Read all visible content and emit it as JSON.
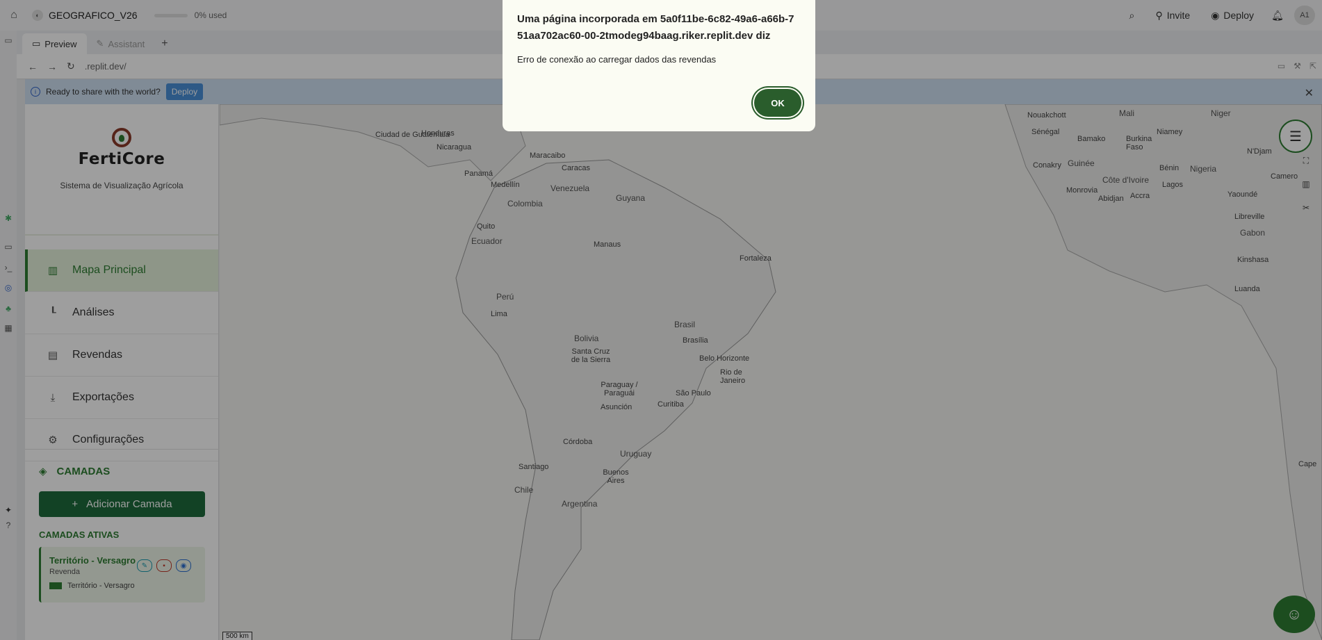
{
  "topbar": {
    "project_name": "GEOGRAFICO_V26",
    "usage": "0% used",
    "invite": "Invite",
    "deploy": "Deploy",
    "avatar": "A1"
  },
  "tabs": [
    {
      "label": "Preview"
    },
    {
      "label": "Assistant"
    },
    {
      "label": "+"
    }
  ],
  "urlbar": {
    "url": ".replit.dev/"
  },
  "banner": {
    "text": "Ready to share with the world?",
    "deploy_label": "Deploy"
  },
  "app": {
    "brand": "FertiCore",
    "tagline": "Sistema de Visualização Agrícola",
    "menu": [
      {
        "label": "Mapa Principal",
        "icon": "map-icon",
        "active": true
      },
      {
        "label": "Análises",
        "icon": "chart-icon"
      },
      {
        "label": "Revendas",
        "icon": "store-icon"
      },
      {
        "label": "Exportações",
        "icon": "download-icon"
      },
      {
        "label": "Configurações",
        "icon": "gear-icon"
      }
    ],
    "layers_title": "CAMADAS",
    "add_layer": "Adicionar Camada",
    "active_layers_title": "CAMADAS ATIVAS",
    "layer": {
      "name": "Território - Versagro",
      "type": "Revenda",
      "legend": "Território - Versagro",
      "color": "#2e7d32"
    }
  },
  "map": {
    "scale": "500 km",
    "places": [
      "Ciudad de Guatemala",
      "Honduras",
      "Nicaragua",
      "Panamá",
      "Maracaibo",
      "Caracas",
      "Medellín",
      "Venezuela",
      "Guyana",
      "Colombia",
      "Quito",
      "Ecuador",
      "Manaus",
      "Fortaleza",
      "Perú",
      "Lima",
      "Brasil",
      "Brasília",
      "Bolivia",
      "Santa Cruz de la Sierra",
      "Belo Horizonte",
      "Rio de Janeiro",
      "São Paulo",
      "Paraguay / Paraguái",
      "Asunción",
      "Curitiba",
      "Córdoba",
      "Uruguay",
      "Santiago",
      "Chile",
      "Buenos Aires",
      "Argentina",
      "Nouakchott",
      "Mali",
      "Niger",
      "Sénégal",
      "Niamey",
      "Bamako",
      "Burkina Faso",
      "Guinée",
      "Conakry",
      "Côte d'Ivoire",
      "Bénin",
      "Nigeria",
      "Lagos",
      "Monrovia",
      "Abidjan",
      "Accra",
      "Yaoundé",
      "Libreville",
      "Gabon",
      "Kinshasa",
      "Luanda",
      "N'Djam",
      "Camero",
      "Cape"
    ]
  },
  "dialog": {
    "title": "Uma página incorporada em 5a0f11be-6c82-49a6-a66b-751aa702ac60-00-2tmodeg94baag.riker.replit.dev diz",
    "message": "Erro de conexão ao carregar dados das revendas",
    "ok": "OK"
  }
}
